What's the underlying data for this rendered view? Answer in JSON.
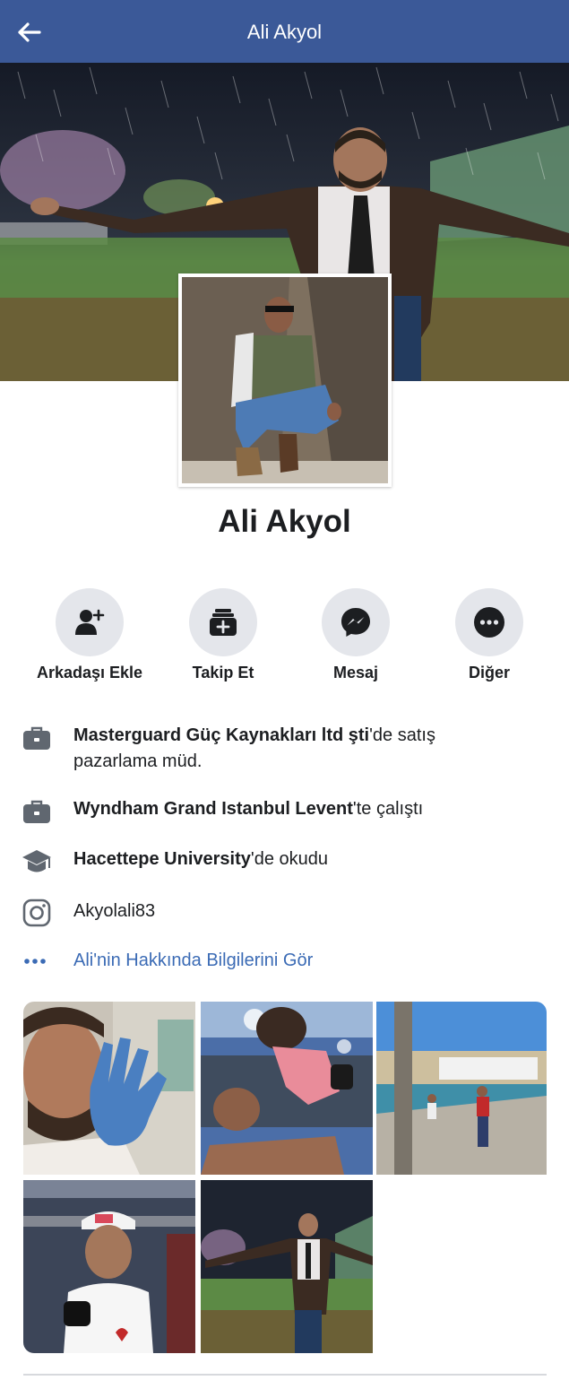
{
  "header": {
    "title": "Ali Akyol"
  },
  "profile": {
    "name": "Ali Akyol"
  },
  "actions": [
    {
      "label": "Arkadaşı Ekle",
      "icon": "add-friend-icon"
    },
    {
      "label": "Takip Et",
      "icon": "follow-icon"
    },
    {
      "label": "Mesaj",
      "icon": "messenger-icon"
    },
    {
      "label": "Diğer",
      "icon": "more-icon"
    }
  ],
  "info": {
    "work1_bold": "Masterguard Güç Kaynakları ltd şti",
    "work1_rest": "'de satış",
    "work1_line2": "pazarlama müd.",
    "work2_bold": "Wyndham Grand Istanbul Levent",
    "work2_rest": "'te çalıştı",
    "edu_bold": "Hacettepe University",
    "edu_rest": "'de okudu",
    "instagram": "Akyolali83",
    "about_link": "Ali'nin Hakkında Bilgilerini Gör"
  },
  "colors": {
    "header_bg": "#3b5998",
    "link": "#3b6bb5",
    "button_bg": "#e4e6eb"
  }
}
